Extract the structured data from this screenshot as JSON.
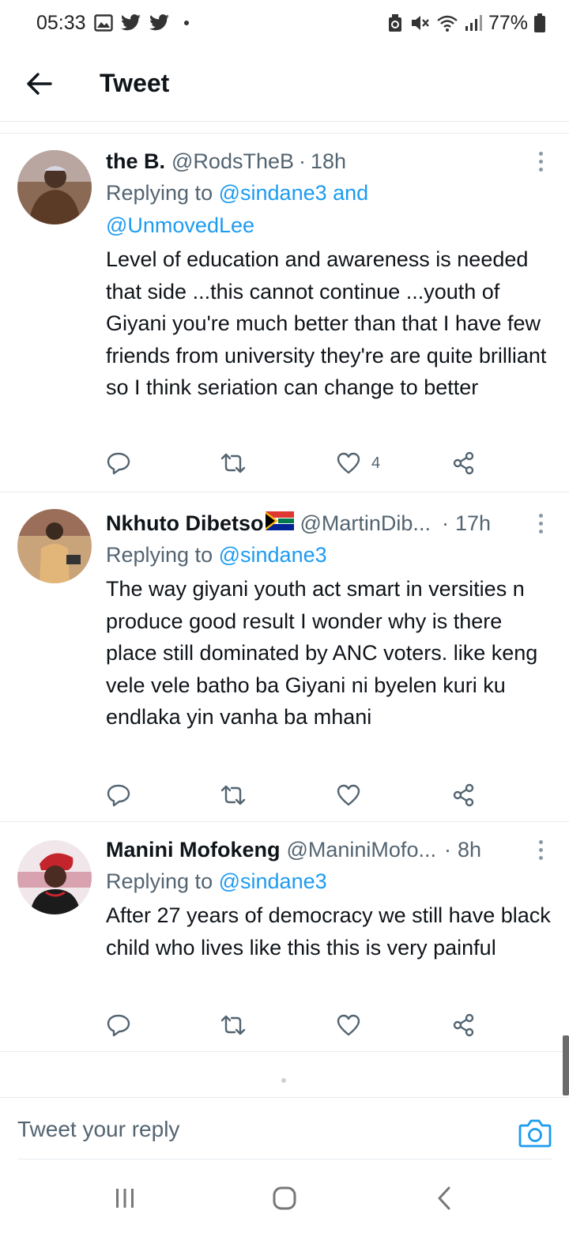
{
  "status_bar": {
    "time": "05:33",
    "battery": "77%",
    "left_icons": [
      "gallery-icon",
      "twitter-icon",
      "twitter-icon"
    ],
    "right_icons": [
      "data-saver-icon",
      "mute-icon",
      "wifi-icon",
      "signal-icon",
      "battery-icon"
    ]
  },
  "header": {
    "title": "Tweet"
  },
  "tweets": [
    {
      "name": "the B.",
      "handle": "@RodsTheB",
      "separator": "·",
      "time": "18h",
      "replying_prefix": "Replying to",
      "replying_line1": "@sindane3 and",
      "replying_line2": "@UnmovedLee",
      "text": "Level of education and awareness is needed that side ...this cannot continue ...youth of Giyani you're much better than that I have few friends from university they're are quite brilliant so I think seriation can change to better",
      "like_count": "4"
    },
    {
      "name": "Nkhuto Dibetso",
      "handle": "@MartinDib...",
      "separator": "·",
      "time": "17h",
      "replying_prefix": "Replying to",
      "replying_line1": "@sindane3",
      "text": "The way giyani youth act smart in versities n produce good result I wonder why is there place still dominated by ANC voters. like keng vele vele batho ba Giyani ni byelen kuri ku endlaka yin vanha ba mhani",
      "like_count": ""
    },
    {
      "name": "Manini Mofokeng",
      "handle": "@ManiniMofo...",
      "separator": "·",
      "time": "8h",
      "replying_prefix": "Replying to",
      "replying_line1": "@sindane3",
      "text": "After 27 years of democracy we still have black child who lives like this this is very painful",
      "like_count": ""
    }
  ],
  "reply_bar": {
    "placeholder": "Tweet your reply"
  },
  "colors": {
    "accent": "#1d9bf0",
    "secondary_text": "#536471",
    "primary_text": "#0f1419",
    "divider": "#e6ecf0"
  }
}
